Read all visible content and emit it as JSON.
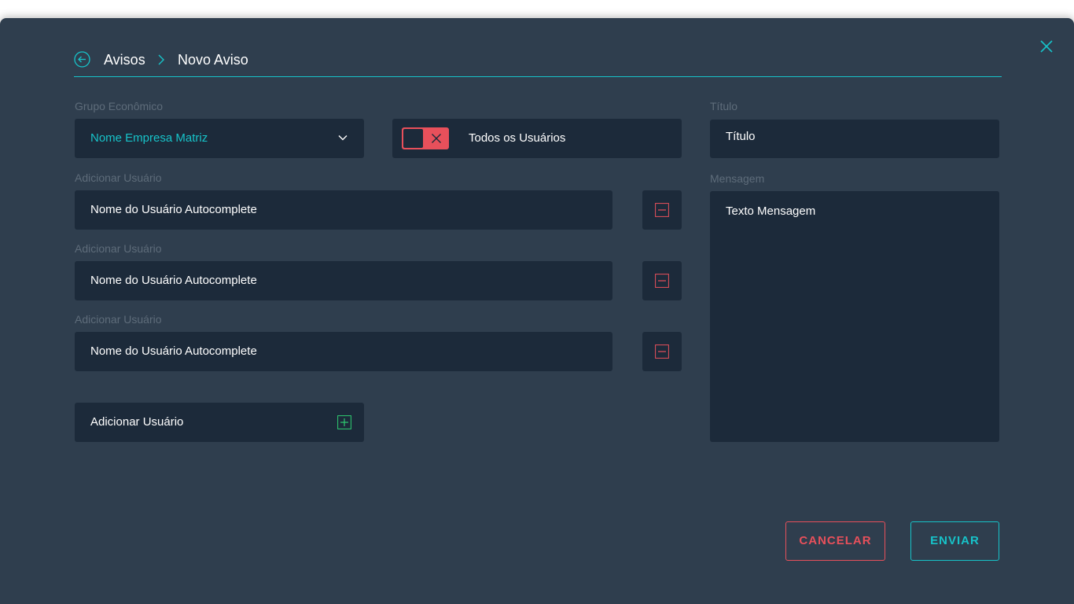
{
  "breadcrumb": {
    "parent": "Avisos",
    "current": "Novo Aviso"
  },
  "grupo": {
    "label": "Grupo Econômico",
    "value": "Nome Empresa Matriz"
  },
  "all_users_toggle": {
    "label": "Todos os Usuários",
    "enabled": false
  },
  "users": [
    {
      "label": "Adicionar Usuário",
      "value": "Nome do Usuário Autocomplete"
    },
    {
      "label": "Adicionar Usuário",
      "value": "Nome do Usuário Autocomplete"
    },
    {
      "label": "Adicionar Usuário",
      "value": "Nome do Usuário Autocomplete"
    }
  ],
  "add_user_button": "Adicionar Usuário",
  "titulo": {
    "label": "Título",
    "placeholder": "Título"
  },
  "mensagem": {
    "label": "Mensagem",
    "placeholder": "Texto Mensagem"
  },
  "actions": {
    "cancel": "CANCELAR",
    "send": "ENVIAR"
  },
  "colors": {
    "background": "#2f3e4e",
    "field": "#1c2a3a",
    "accent": "#17c3c9",
    "danger": "#e8505b",
    "success": "#2ecc71"
  },
  "icons": {
    "close": "close-icon",
    "back": "back-arrow-icon",
    "separator": "chevron-right-icon",
    "dropdown": "chevron-down-icon",
    "toggle": "x-icon",
    "remove": "minus-icon",
    "add": "plus-icon"
  }
}
